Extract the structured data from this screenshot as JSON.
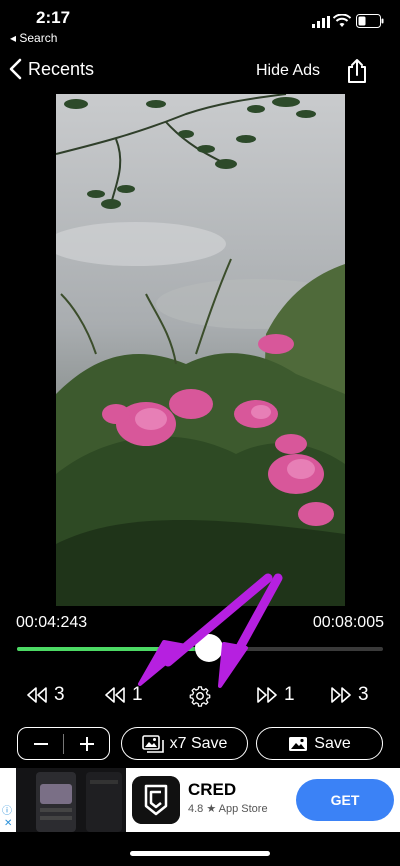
{
  "status": {
    "time": "2:17",
    "back_app": "◂ Search"
  },
  "nav": {
    "back_label": "Recents",
    "hide_ads": "Hide Ads"
  },
  "playback": {
    "current_time": "00:04:243",
    "total_time": "00:08:005",
    "progress": 0.525
  },
  "controls": {
    "rewind_3": "3",
    "rewind_1": "1",
    "forward_1": "1",
    "forward_3": "3"
  },
  "actions": {
    "multi_save": "x7 Save",
    "save": "Save"
  },
  "ad": {
    "title": "CRED",
    "subtitle": "4.8 ★ App Store",
    "cta": "GET"
  },
  "colors": {
    "progress": "#4cd964",
    "annotation_arrow": "#b620e0",
    "ad_button": "#3b82f6"
  }
}
